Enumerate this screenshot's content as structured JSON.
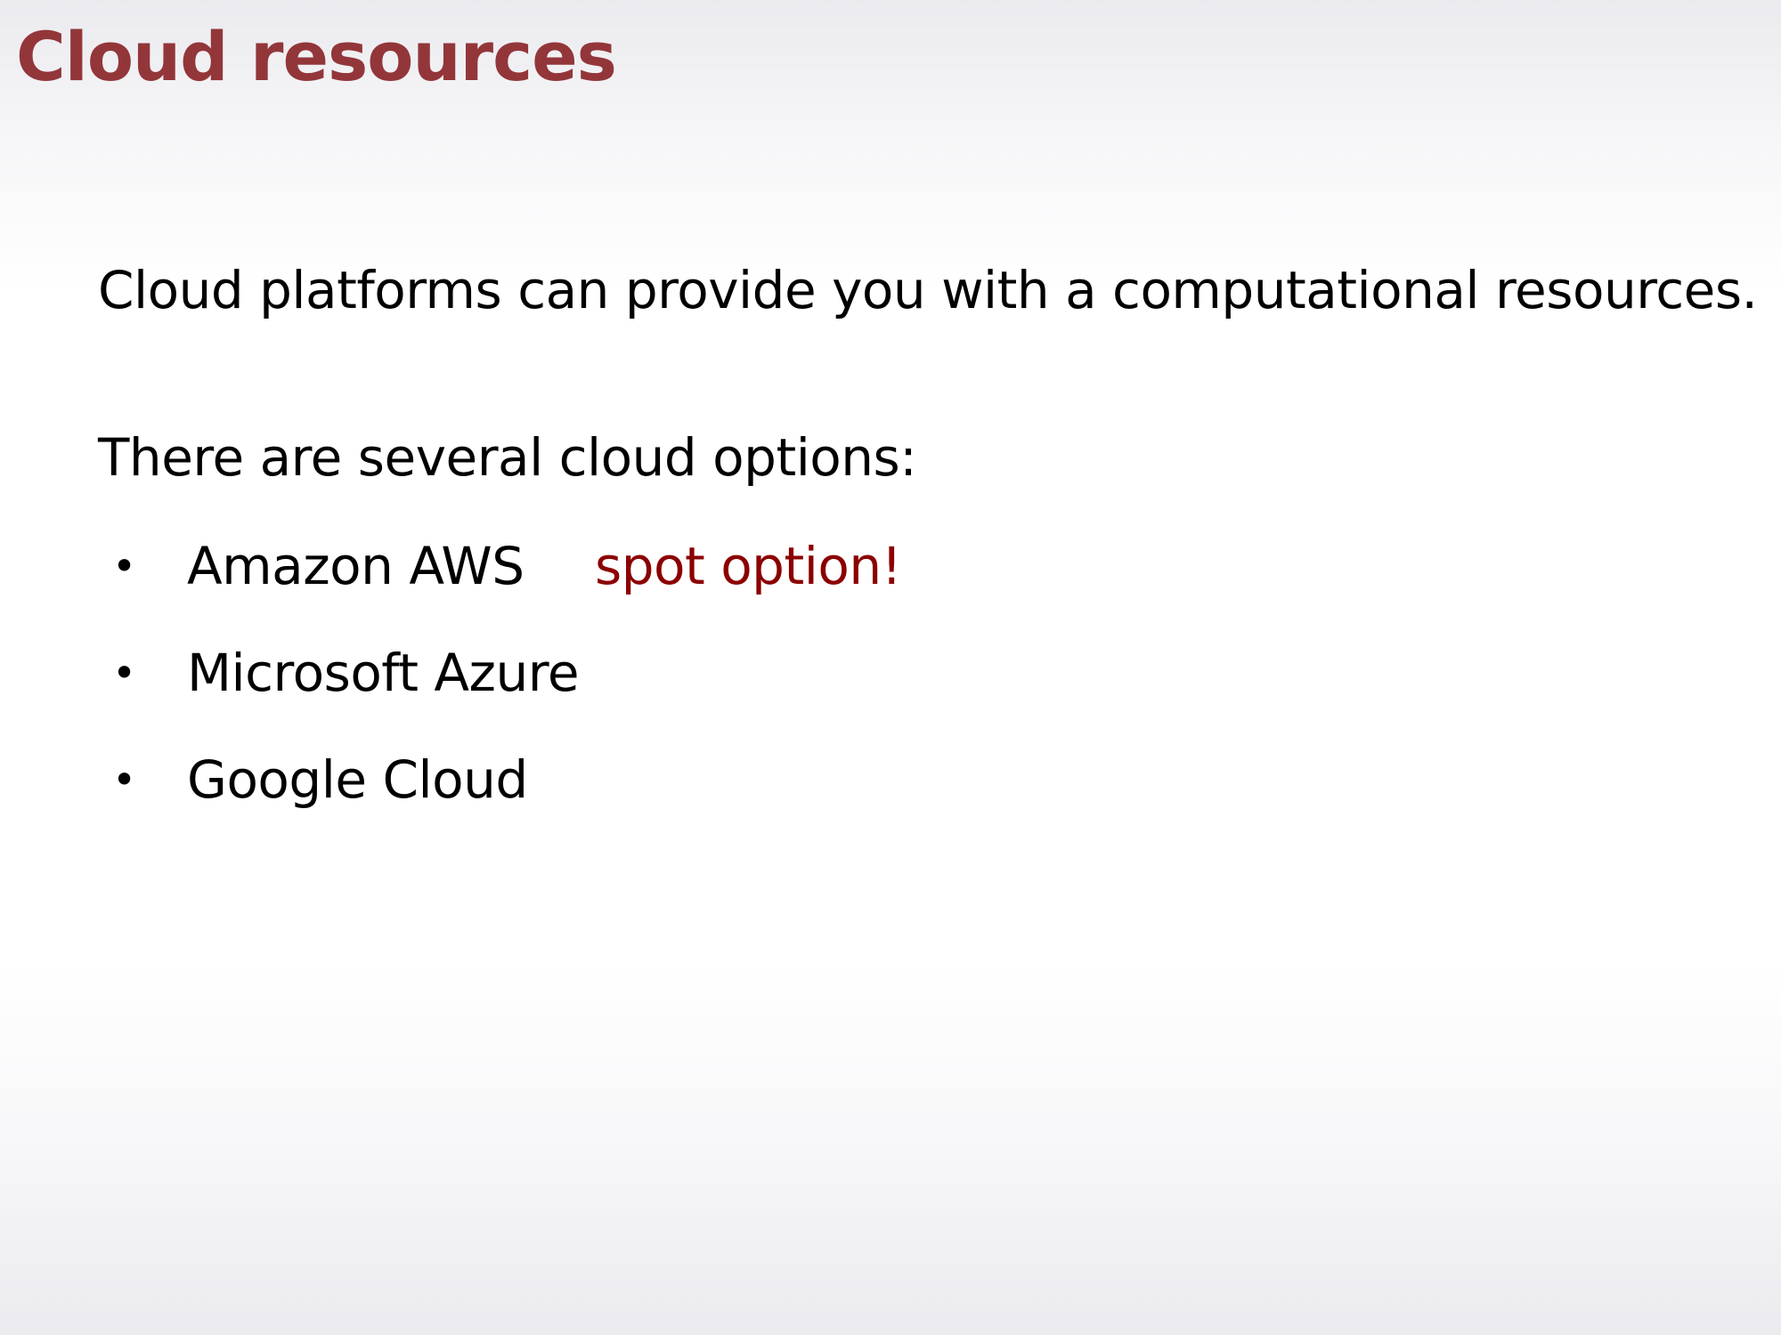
{
  "slide": {
    "title": "Cloud resources",
    "paragraph_1": "Cloud platforms can provide you with a computational resources.",
    "paragraph_2": "There are several cloud options:",
    "bullet_symbol": "•",
    "bullets": [
      {
        "label": "Amazon AWS",
        "note": "spot option!"
      },
      {
        "label": "Microsoft Azure",
        "note": ""
      },
      {
        "label": "Google Cloud",
        "note": ""
      }
    ]
  },
  "colors": {
    "title": "#93363a",
    "note": "#8b0000",
    "text": "#000000"
  }
}
